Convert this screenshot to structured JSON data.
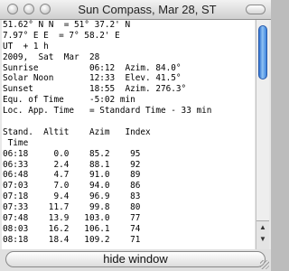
{
  "window": {
    "title": "Sun Compass, Mar 28, ST"
  },
  "report": {
    "lines": [
      "51.62° N N  = 51° 37.2' N",
      "7.97° E E  = 7° 58.2' E",
      "UT  + 1 h",
      "2009,  Sat  Mar  28",
      "Sunrise          06:12  Azim. 84.0°",
      "Solar Noon       12:33  Elev. 41.5°",
      "Sunset           18:55  Azim. 276.3°",
      "Equ. of Time     -5:02 min",
      "Loc. App. Time   = Standard Time - 33 min",
      "",
      "Stand.  Altit    Azim   Index",
      " Time",
      "06:18     0.0    85.2    95",
      "06:33     2.4    88.1    92",
      "06:48     4.7    91.0    89",
      "07:03     7.0    94.0    86",
      "07:18     9.4    96.9    83",
      "07:33    11.7    99.8    80",
      "07:48    13.9   103.0    77",
      "08:03    16.2   106.1    74",
      "08:18    18.4   109.2    71"
    ]
  },
  "buttons": {
    "hide_window": "hide window"
  }
}
